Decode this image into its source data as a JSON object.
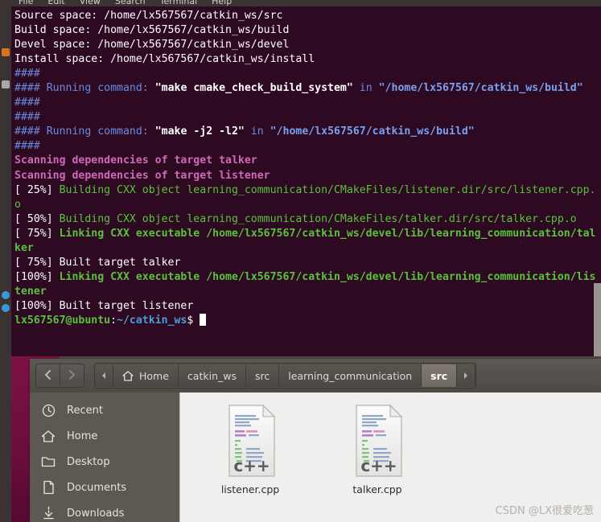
{
  "desktop": {
    "launcher_icons": [
      "app-icon-1",
      "app-icon-2",
      "app-icon-3"
    ]
  },
  "terminal": {
    "menu": [
      {
        "label": "File",
        "name": "menu-file"
      },
      {
        "label": "Edit",
        "name": "menu-edit"
      },
      {
        "label": "View",
        "name": "menu-view"
      },
      {
        "label": "Search",
        "name": "menu-search"
      },
      {
        "label": "Terminal",
        "name": "menu-terminal"
      },
      {
        "label": "Help",
        "name": "menu-help"
      }
    ],
    "colors": {
      "background": "#2d0922",
      "white": "#ffffff",
      "blue": "#6a8ce0",
      "green": "#5ac23c",
      "magenta": "#d06ab8",
      "cyan": "#4a9fd8"
    },
    "lines": {
      "l1": "Source space: /home/lx567567/catkin_ws/src",
      "l2": "Build space: /home/lx567567/catkin_ws/build",
      "l3": "Devel space: /home/lx567567/catkin_ws/devel",
      "l4": "Install space: /home/lx567567/catkin_ws/install",
      "l5": "####",
      "l6_hash": "#### Running command:",
      "l6_cmd": "\"make cmake_check_build_system\"",
      "l6_in": "in",
      "l6_path": "\"/home/lx567567/catkin_ws/build\"",
      "l7": "####",
      "l8": "####",
      "l9_hash": "#### Running command:",
      "l9_cmd": "\"make -j2 -l2\"",
      "l9_in": "in",
      "l9_path": "\"/home/lx567567/catkin_ws/build\"",
      "l10": "####",
      "l11": "Scanning dependencies of target talker",
      "l12": "Scanning dependencies of target listener",
      "l13_pct": "[ 25%]",
      "l13_txt": " Building CXX object learning_communication/CMakeFiles/listener.dir/src/listener.cpp.o",
      "l14_pct": "[ 50%]",
      "l14_txt": " Building CXX object learning_communication/CMakeFiles/talker.dir/src/talker.cpp.o",
      "l15_pct": "[ 75%]",
      "l15_txt": " Linking CXX executable /home/lx567567/catkin_ws/devel/lib/learning_communication/talker",
      "l16": "[ 75%] Built target talker",
      "l17_pct": "[100%]",
      "l17_txt": " Linking CXX executable /home/lx567567/catkin_ws/devel/lib/learning_communication/listener",
      "l18": "[100%] Built target listener",
      "prompt_user": "lx567567@ubuntu",
      "prompt_colon": ":",
      "prompt_path": "~/catkin_ws",
      "prompt_sign": "$"
    }
  },
  "file_manager": {
    "nav": {
      "back": "back-arrow",
      "forward": "forward-arrow"
    },
    "breadcrumbs": [
      {
        "label": "",
        "name": "breadcrumb-scroll-left",
        "icon": "chevron-left-icon",
        "type": "arrow"
      },
      {
        "label": "Home",
        "name": "breadcrumb-home",
        "icon": "home-icon",
        "type": "crumb"
      },
      {
        "label": "catkin_ws",
        "name": "breadcrumb-catkin-ws",
        "type": "crumb"
      },
      {
        "label": "src",
        "name": "breadcrumb-src",
        "type": "crumb"
      },
      {
        "label": "learning_communication",
        "name": "breadcrumb-learning-communication",
        "type": "crumb"
      },
      {
        "label": "src",
        "name": "breadcrumb-src-active",
        "type": "crumb-active"
      },
      {
        "label": "",
        "name": "breadcrumb-scroll-right",
        "icon": "chevron-right-icon",
        "type": "arrow"
      }
    ],
    "sidebar": [
      {
        "label": "Recent",
        "icon": "clock-icon",
        "name": "sidebar-item-recent"
      },
      {
        "label": "Home",
        "icon": "home-icon",
        "name": "sidebar-item-home"
      },
      {
        "label": "Desktop",
        "icon": "folder-icon",
        "name": "sidebar-item-desktop"
      },
      {
        "label": "Documents",
        "icon": "document-icon",
        "name": "sidebar-item-documents"
      },
      {
        "label": "Downloads",
        "icon": "download-icon",
        "name": "sidebar-item-downloads"
      }
    ],
    "files": [
      {
        "name": "listener.cpp",
        "type": "c++",
        "icon": "cpp-source-file-icon"
      },
      {
        "name": "talker.cpp",
        "type": "c++",
        "icon": "cpp-source-file-icon"
      }
    ]
  },
  "watermark": {
    "text": "CSDN @LX很爱吃葱"
  }
}
